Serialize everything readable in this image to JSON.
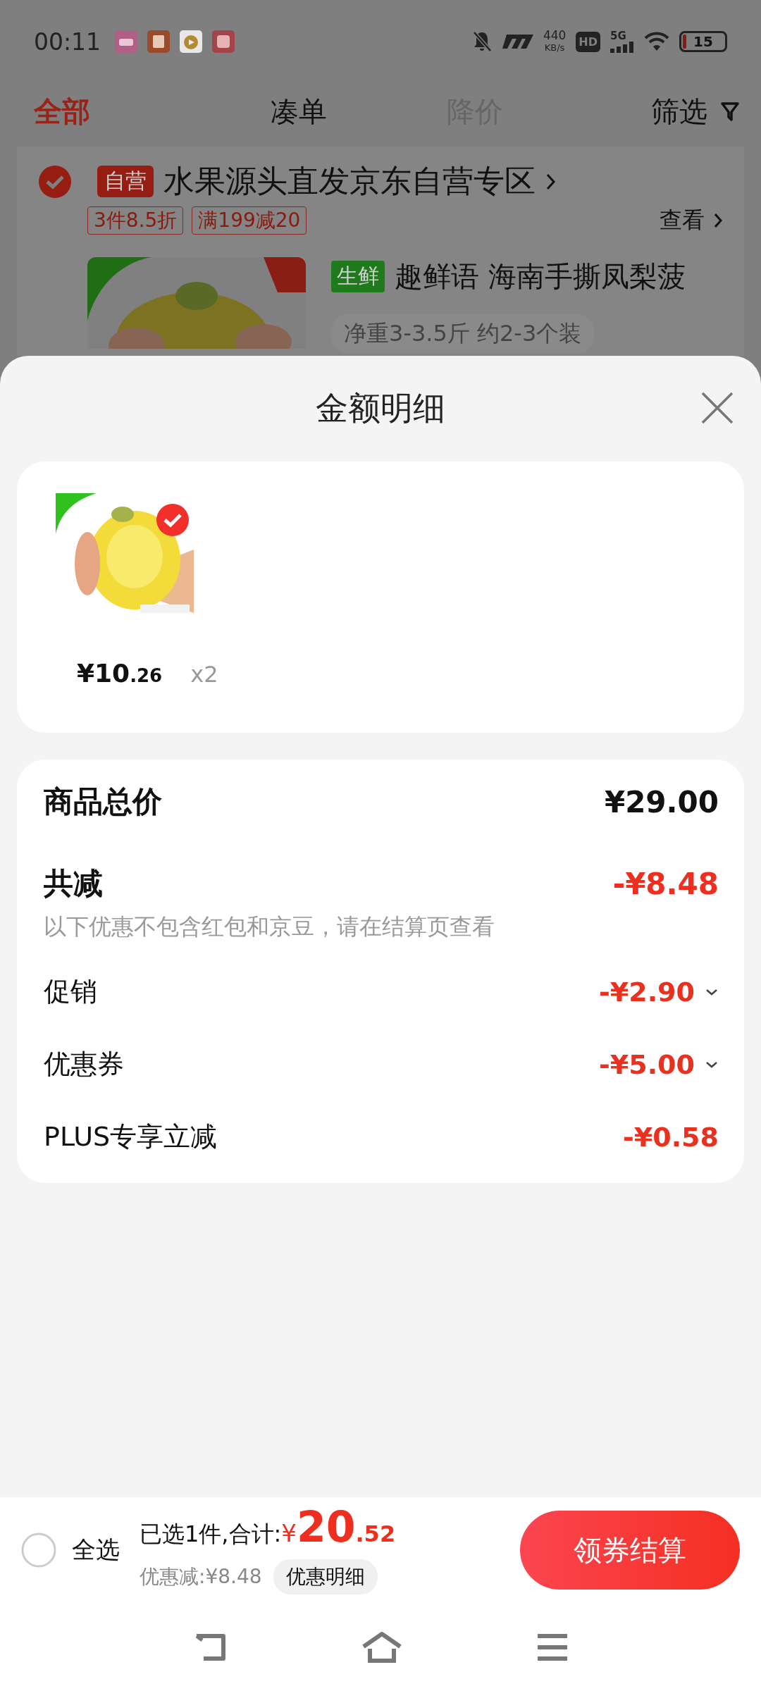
{
  "status_bar": {
    "time": "00:11",
    "network_speed": "440",
    "speed_unit": "KB/s",
    "hd": "HD",
    "network": "5G",
    "battery": "15"
  },
  "tabs": [
    {
      "label": "全部",
      "selected": true,
      "disabled": false
    },
    {
      "label": "凑单",
      "selected": false,
      "disabled": false
    },
    {
      "label": "降价",
      "selected": false,
      "disabled": true
    }
  ],
  "filter": {
    "label": "筛选"
  },
  "store": {
    "checked": true,
    "badge": "自营",
    "name": "水果源头直发京东自营专区",
    "promos": [
      "3件8.5折",
      "满199减20"
    ],
    "view_link": "查看"
  },
  "product": {
    "tag": "生鲜",
    "title": "趣鲜语 海南手撕凤梨菠",
    "spec": "净重3-3.5斤 约2-3个装"
  },
  "sheet": {
    "title": "金额明细",
    "items": [
      {
        "price": "¥10",
        "price_cents": ".26",
        "quantity": "x2",
        "checked": true
      }
    ],
    "summary": {
      "total_label": "商品总价",
      "total": "¥29.00",
      "discount_label": "共减",
      "discount": "-¥8.48",
      "note": "以下优惠不包含红包和京豆，请在结算页查看",
      "rows": [
        {
          "label": "促销",
          "amount": "-¥2.90",
          "expandable": true
        },
        {
          "label": "优惠券",
          "amount": "-¥5.00",
          "expandable": true
        },
        {
          "label": "PLUS专享立减",
          "amount": "-¥0.58",
          "expandable": false
        }
      ]
    }
  },
  "checkout": {
    "select_all": {
      "label": "全选",
      "checked": false
    },
    "selected_text": "已选1件,合计:",
    "currency": "¥",
    "total": "20",
    "total_cents": ".52",
    "saved": "优惠减:¥8.48",
    "detail_button": "优惠明细",
    "pay_button": "领券结算"
  }
}
